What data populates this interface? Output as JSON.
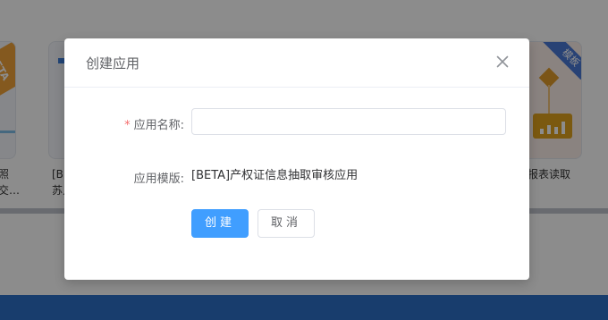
{
  "background": {
    "cards": {
      "left_badge": "BETA",
      "left_label": "照\n交…",
      "mid_label": "[BE\n苏人",
      "right_badge": "模板",
      "right_label": "报表读取"
    }
  },
  "dialog": {
    "title": "创建应用",
    "close_icon": "close-icon",
    "fields": {
      "name": {
        "label": "应用名称:",
        "required_mark": "*",
        "value": "",
        "placeholder": ""
      },
      "template": {
        "label": "应用模版:",
        "value": "[BETA]产权证信息抽取审核应用"
      }
    },
    "buttons": {
      "create": "创建",
      "cancel": "取消"
    }
  },
  "colors": {
    "primary": "#409eff",
    "required": "#f56c6c",
    "footer": "#2d6fc6"
  }
}
